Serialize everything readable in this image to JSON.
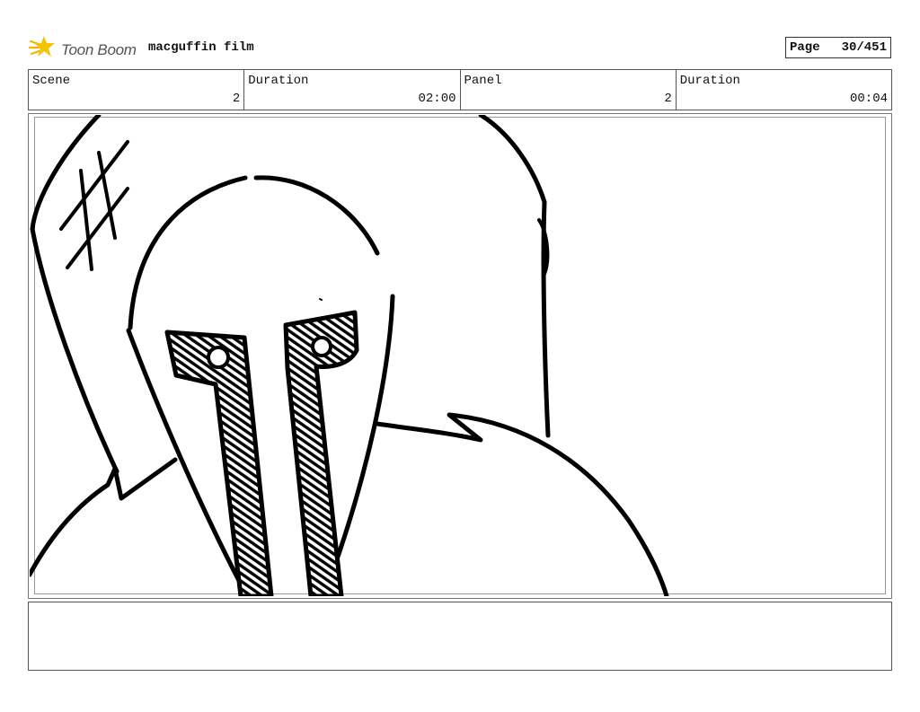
{
  "header": {
    "logo_text": "Toon Boom",
    "project_title": "macguffin film",
    "page_label": "Page",
    "page_number": "30/451"
  },
  "info": {
    "scene_label": "Scene",
    "scene_value": "2",
    "scene_duration_label": "Duration",
    "scene_duration_value": "02:00",
    "panel_label": "Panel",
    "panel_value": "2",
    "panel_duration_label": "Duration",
    "panel_duration_value": "00:04"
  },
  "notes": {
    "text": ""
  },
  "icons": {
    "logo": "toon-boom-logo-icon"
  }
}
